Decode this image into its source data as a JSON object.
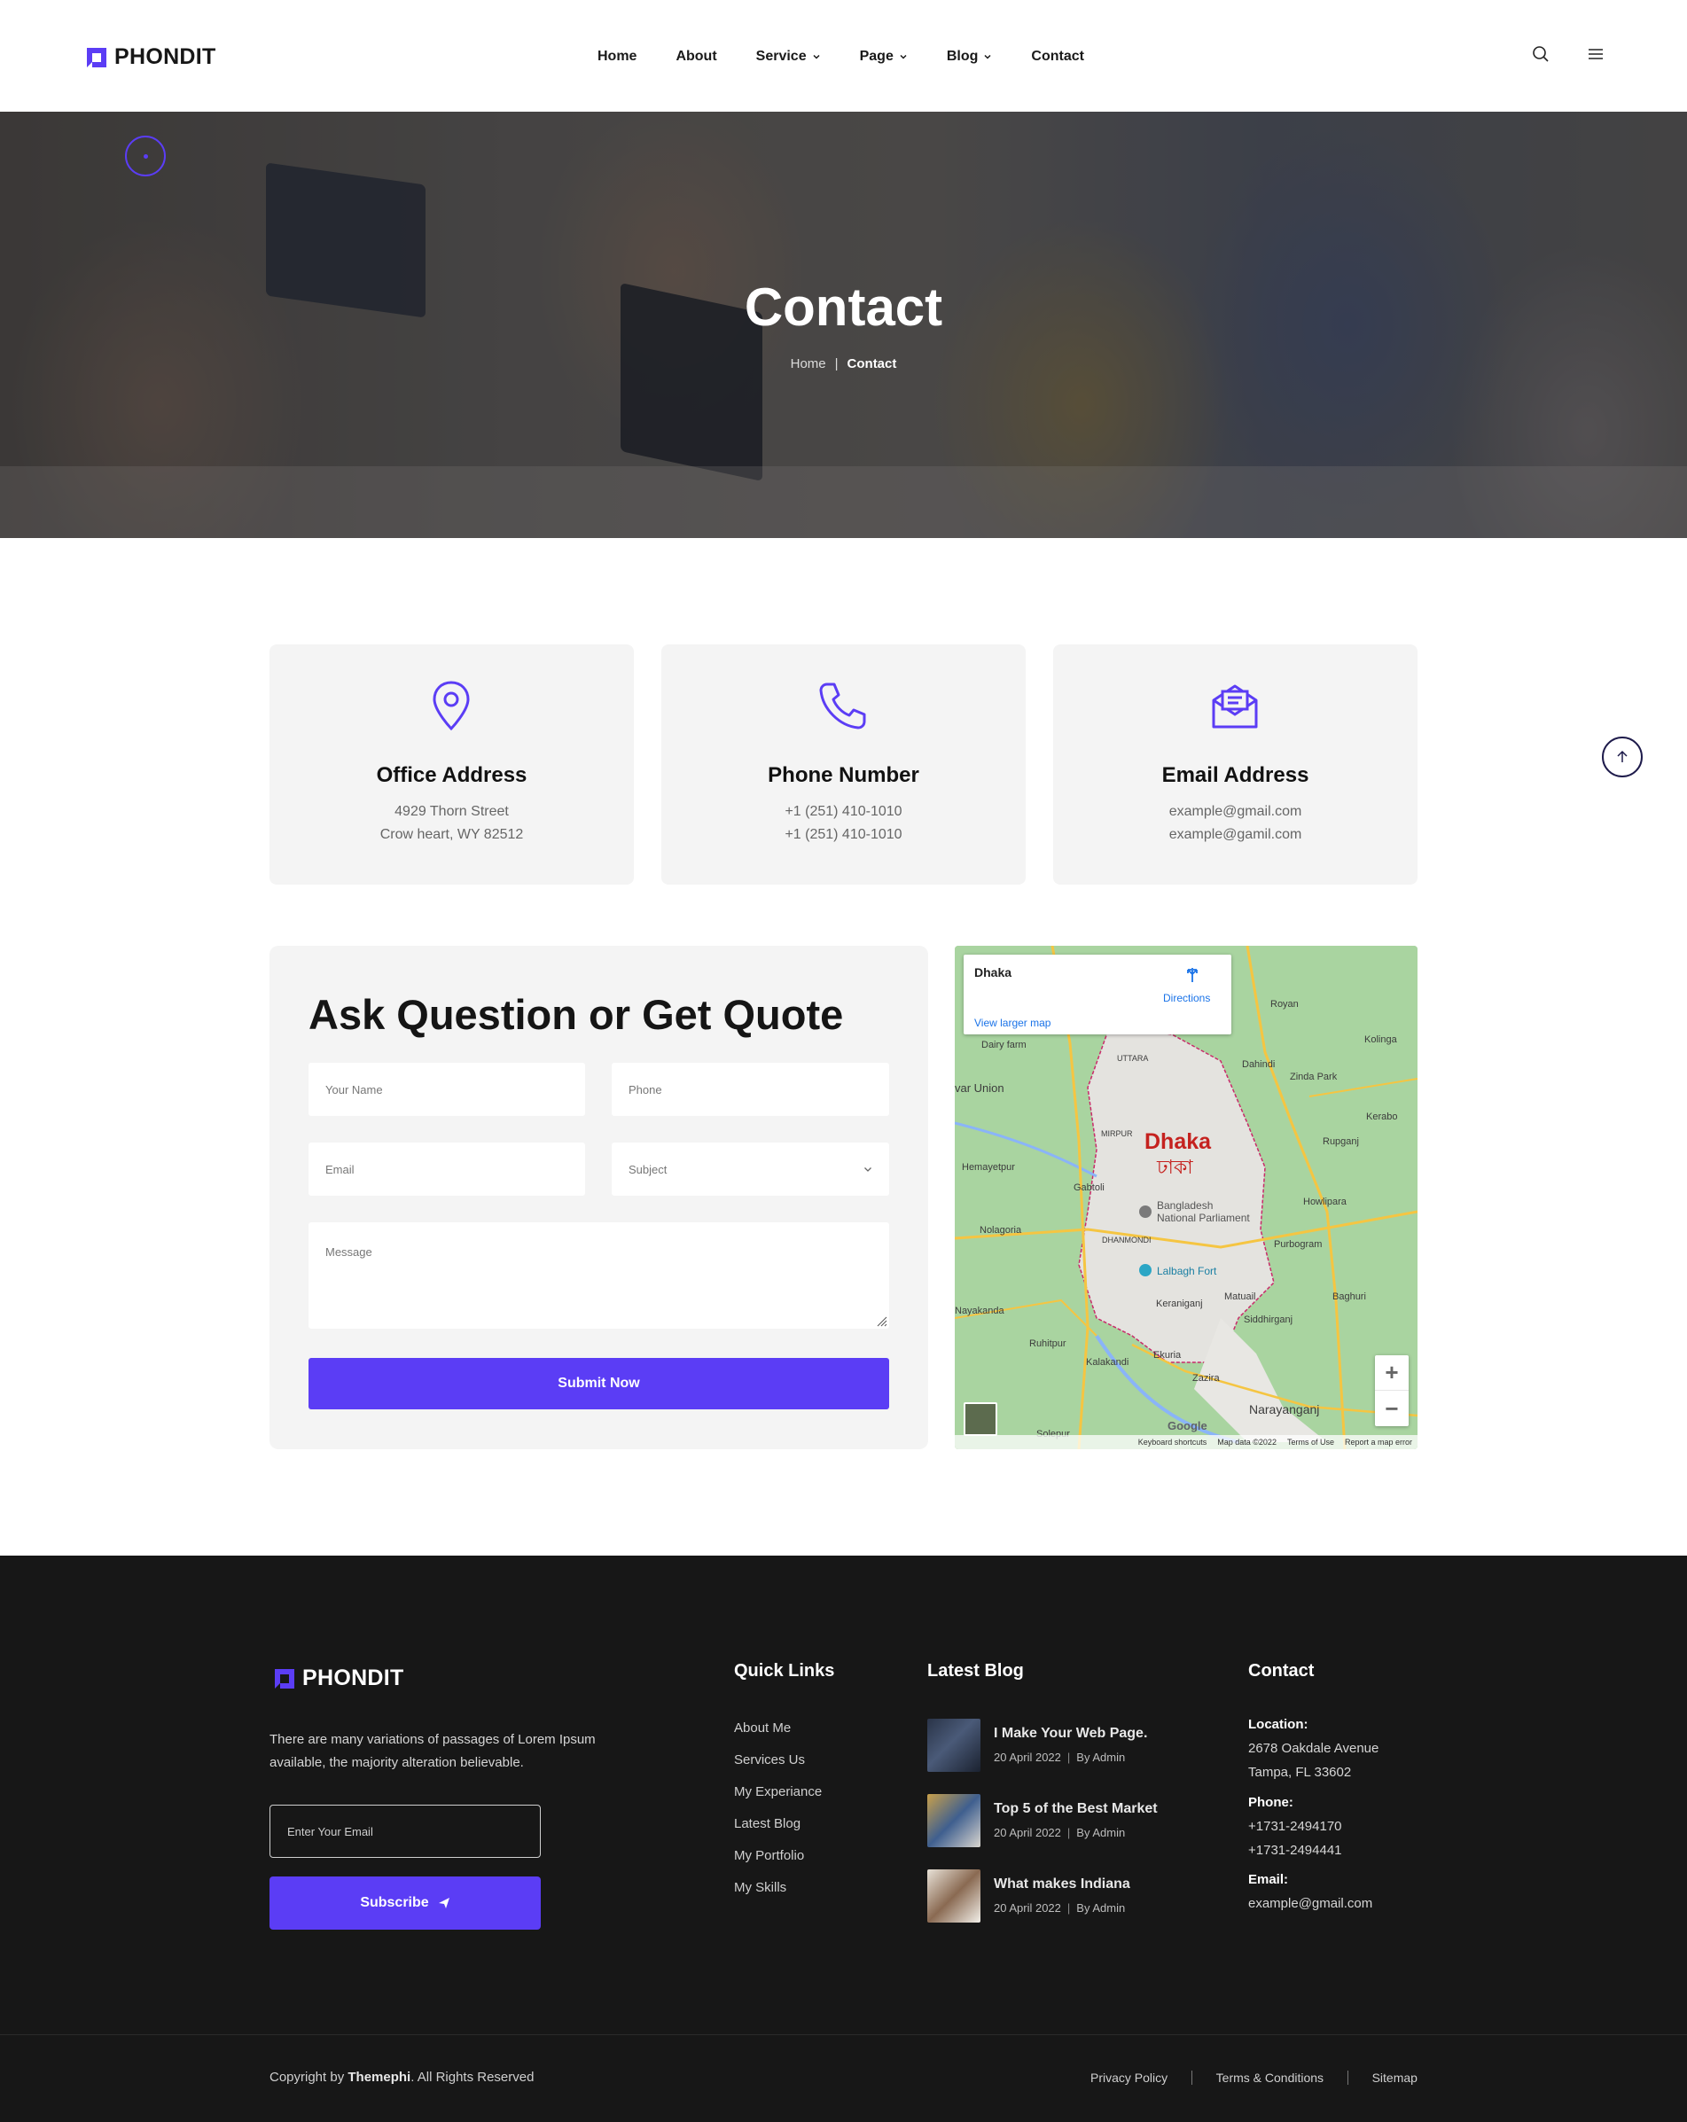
{
  "brand": {
    "name": "PHONDIT",
    "accent_color": "#5b3df5"
  },
  "nav": {
    "items": [
      {
        "label": "Home",
        "dropdown": false
      },
      {
        "label": "About",
        "dropdown": false
      },
      {
        "label": "Service",
        "dropdown": true
      },
      {
        "label": "Page",
        "dropdown": true
      },
      {
        "label": "Blog",
        "dropdown": true
      },
      {
        "label": "Contact",
        "dropdown": false
      }
    ],
    "icons": [
      "search-icon",
      "menu-icon"
    ]
  },
  "hero": {
    "title": "Contact",
    "breadcrumb": {
      "home": "Home",
      "separator": "|",
      "current": "Contact"
    }
  },
  "info_cards": [
    {
      "icon": "map-pin-icon",
      "title": "Office Address",
      "line1": "4929 Thorn Street",
      "line2": "Crow heart, WY 82512"
    },
    {
      "icon": "phone-icon",
      "title": "Phone Number",
      "line1": "+1 (251) 410-1010",
      "line2": "+1 (251) 410-1010"
    },
    {
      "icon": "envelope-icon",
      "title": "Email Address",
      "line1": "example@gmail.com",
      "line2": "example@gamil.com"
    }
  ],
  "form": {
    "title": "Ask Question or Get Quote",
    "name_placeholder": "Your Name",
    "phone_placeholder": "Phone",
    "email_placeholder": "Email",
    "subject_placeholder": "Subject",
    "message_placeholder": "Message",
    "submit_label": "Submit Now"
  },
  "map": {
    "place": "Dhaka",
    "directions": "Directions",
    "view_larger": "View larger map",
    "city_en": "Dhaka",
    "city_bn": "ঢাকা",
    "labels": {
      "royan": "Royan",
      "dairy_farm": "Dairy farm",
      "uttara": "UTTARA",
      "dahindi": "Dahindi",
      "zinda_park": "Zinda Park",
      "kolinga": "Kolinga",
      "savar": "var Union",
      "mirpur": "MIRPUR",
      "kerabo": "Kerabo",
      "hemayetpur": "Hemayetpur",
      "rupganj": "Rupganj",
      "gabtoli": "Gabtoli",
      "parliament": "Bangladesh National Parliament",
      "howlipara": "Howlipara",
      "nolagoria": "Nolagoria",
      "dhanmondi": "DHANMONDI",
      "purbogram": "Purbogram",
      "lalbagh": "Lalbagh Fort",
      "matuail": "Matuail",
      "keraniganj": "Keraniganj",
      "siddhirganj": "Siddhirganj",
      "nayakanda": "Nayakanda",
      "ruhitpur": "Ruhitpur",
      "kalakandi": "Kalakandi",
      "ekuria": "Ekuria",
      "zazira": "Zazira",
      "narayanganj": "Narayanganj",
      "solepur": "Solepur",
      "baghuri": "Baghuri"
    },
    "zoom_in": "+",
    "zoom_out": "−",
    "google": "Google",
    "attribution": [
      "Keyboard shortcuts",
      "Map data ©2022",
      "Terms of Use",
      "Report a map error"
    ]
  },
  "footer": {
    "about": "There are many variations of passages of Lorem Ipsum available, the majority alteration believable.",
    "email_placeholder": "Enter Your Email",
    "subscribe_label": "Subscribe",
    "quick_links_title": "Quick Links",
    "quick_links": [
      "About Me",
      "Services Us",
      "My Experiance",
      "Latest Blog",
      "My Portfolio",
      "My Skills"
    ],
    "blog_title": "Latest Blog",
    "blogs": [
      {
        "title": "I Make Your Web Page.",
        "date": "20 April 2022",
        "author": "By Admin"
      },
      {
        "title": "Top 5 of the Best Market",
        "date": "20 April 2022",
        "author": "By Admin"
      },
      {
        "title": "What makes Indiana",
        "date": "20 April 2022",
        "author": "By Admin"
      }
    ],
    "contact_title": "Contact",
    "location_label": "Location:",
    "location_line1": "2678 Oakdale Avenue",
    "location_line2": "Tampa, FL 33602",
    "phone_label": "Phone:",
    "phone1": "+1731-2494170",
    "phone2": "+1731-2494441",
    "email_label": "Email:",
    "email": "example@gmail.com",
    "copyright_prefix": "Copyright by ",
    "copyright_brand": "Themephi",
    "copyright_suffix": ". All Rights Reserved",
    "legal": [
      "Privacy Policy",
      "Terms & Conditions",
      "Sitemap"
    ]
  }
}
